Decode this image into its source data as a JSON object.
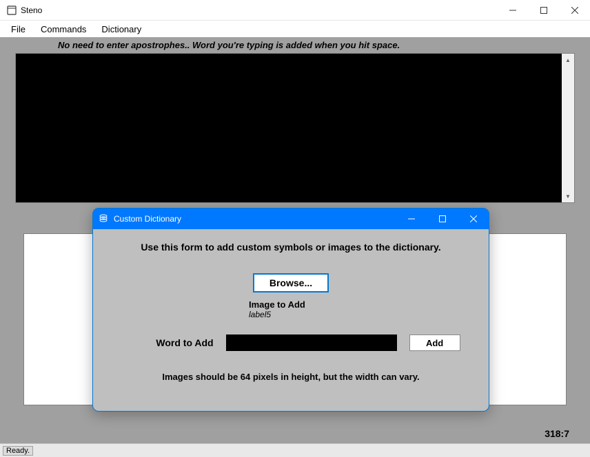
{
  "main": {
    "title": "Steno",
    "menu": {
      "file": "File",
      "commands": "Commands",
      "dictionary": "Dictionary"
    },
    "hint": "No need to enter apostrophes.. Word you're typing is  added when you hit space.",
    "coord": "318:7",
    "status": "Ready."
  },
  "dialog": {
    "title": "Custom Dictionary",
    "heading": "Use this form to add custom symbols or images to the dictionary.",
    "browse_label": "Browse...",
    "image_label": "Image to Add",
    "image_sub": "label5",
    "word_label": "Word to Add",
    "word_value": "",
    "add_label": "Add",
    "note": "Images should be 64 pixels in height, but the width can vary."
  }
}
